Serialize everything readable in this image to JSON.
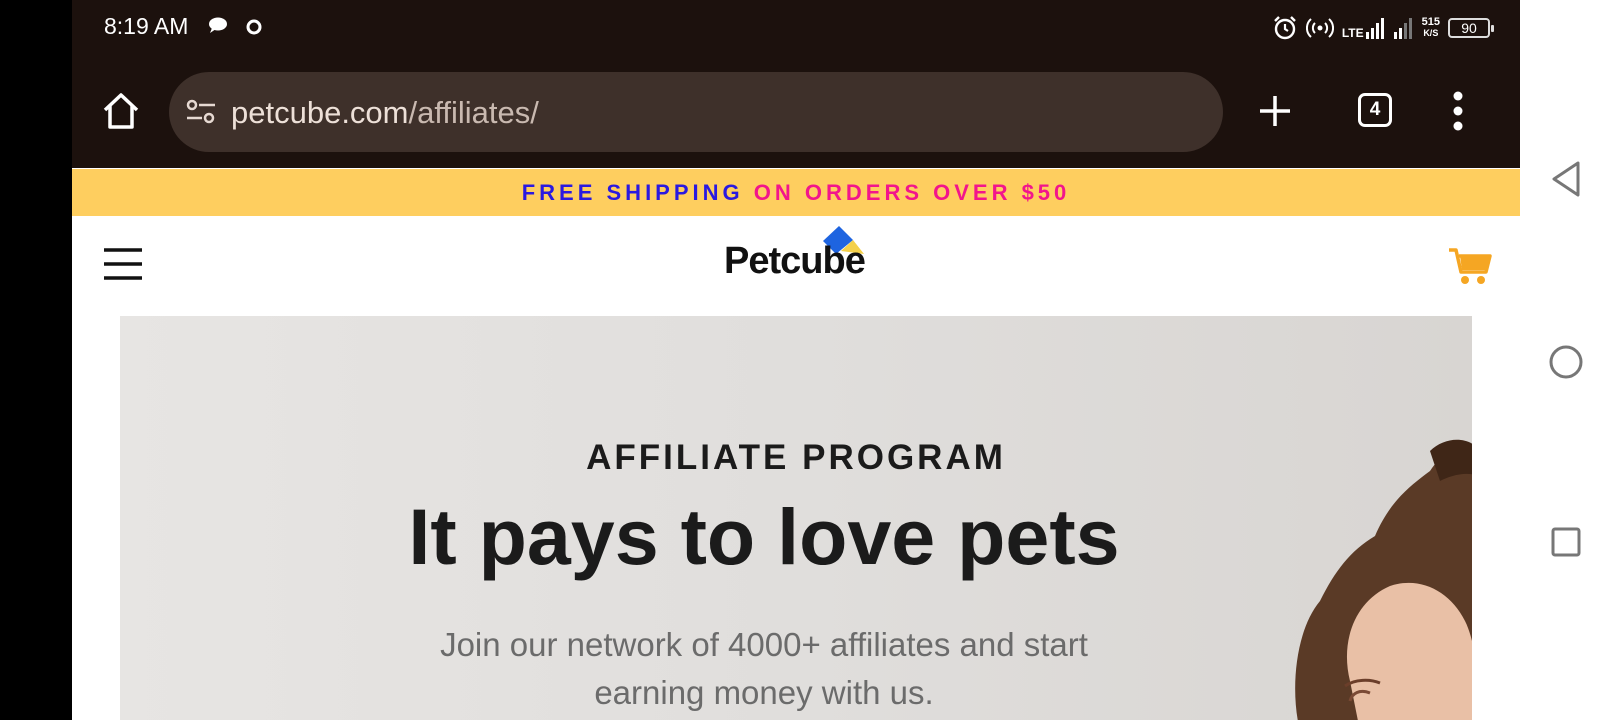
{
  "status_bar": {
    "time": "8:19 AM",
    "network": "LTE",
    "net_speed_value": "515",
    "net_speed_unit": "K/S",
    "battery": "90"
  },
  "browser": {
    "url_host": "petcube.com",
    "url_path": "/affiliates/",
    "tab_count": "4"
  },
  "promo": {
    "part1": "FREE SHIPPING",
    "part2": "ON ORDERS OVER $50",
    "colors": {
      "part1": "#2a19e0",
      "part2": "#f2158c",
      "background": "#fece5f"
    }
  },
  "site": {
    "logo_text": "Petcube"
  },
  "hero": {
    "eyebrow": "AFFILIATE PROGRAM",
    "headline": "It pays to love pets",
    "subline": "Join our network of 4000+ affiliates and start earning money with us."
  },
  "icons": {
    "status": [
      "chat-icon",
      "sync-icon",
      "alarm-icon",
      "hotspot-icon",
      "signal-icon",
      "battery-icon"
    ],
    "toolbar": [
      "home-icon",
      "site-settings-icon",
      "plus-icon",
      "tabs-icon",
      "more-icon"
    ],
    "site": [
      "hamburger-icon",
      "cart-icon"
    ],
    "nav": [
      "back-icon",
      "home-circle-icon",
      "recents-icon"
    ]
  }
}
